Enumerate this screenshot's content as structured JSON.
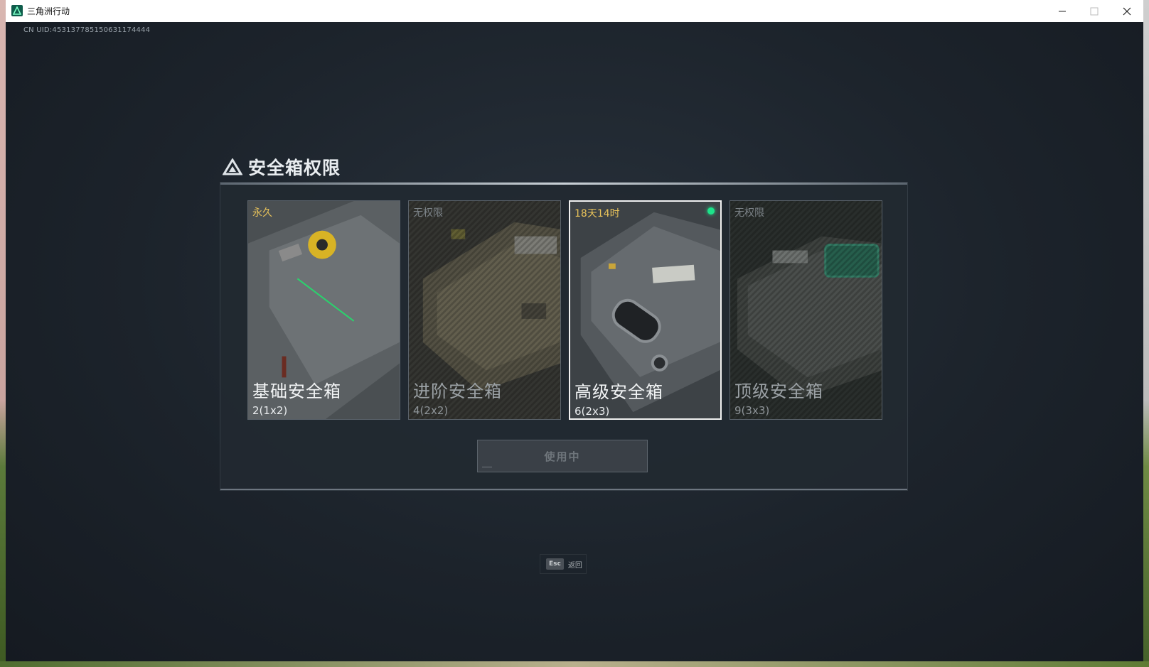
{
  "window": {
    "title": "三角洲行动",
    "minimize_icon": "minimize-icon",
    "maximize_icon": "maximize-icon",
    "close_icon": "close-icon"
  },
  "game": {
    "uid": "CN UID:453137785150631174444"
  },
  "panel": {
    "title": "安全箱权限",
    "cards": [
      {
        "status": "永久",
        "name": "基础安全箱",
        "capacity": "2(1x2)",
        "unlocked": true,
        "selected": false
      },
      {
        "status": "无权限",
        "name": "进阶安全箱",
        "capacity": "4(2x2)",
        "unlocked": false,
        "selected": false
      },
      {
        "status": "18天14时",
        "name": "高级安全箱",
        "capacity": "6(2x3)",
        "unlocked": true,
        "selected": true
      },
      {
        "status": "无权限",
        "name": "顶级安全箱",
        "capacity": "9(3x3)",
        "unlocked": false,
        "selected": false
      }
    ],
    "use_button": "使用中"
  },
  "footer": {
    "esc_key": "Esc",
    "esc_label": "返回"
  },
  "colors": {
    "active_green": "#1de38a",
    "status_gold": "#e8c25a"
  }
}
